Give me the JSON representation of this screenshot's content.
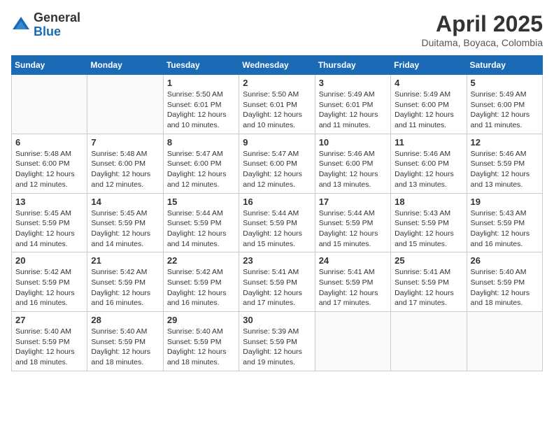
{
  "logo": {
    "general": "General",
    "blue": "Blue"
  },
  "title": {
    "month": "April 2025",
    "location": "Duitama, Boyaca, Colombia"
  },
  "weekdays": [
    "Sunday",
    "Monday",
    "Tuesday",
    "Wednesday",
    "Thursday",
    "Friday",
    "Saturday"
  ],
  "weeks": [
    [
      {
        "day": "",
        "sunrise": "",
        "sunset": "",
        "daylight": ""
      },
      {
        "day": "",
        "sunrise": "",
        "sunset": "",
        "daylight": ""
      },
      {
        "day": "1",
        "sunrise": "Sunrise: 5:50 AM",
        "sunset": "Sunset: 6:01 PM",
        "daylight": "Daylight: 12 hours and 10 minutes."
      },
      {
        "day": "2",
        "sunrise": "Sunrise: 5:50 AM",
        "sunset": "Sunset: 6:01 PM",
        "daylight": "Daylight: 12 hours and 10 minutes."
      },
      {
        "day": "3",
        "sunrise": "Sunrise: 5:49 AM",
        "sunset": "Sunset: 6:01 PM",
        "daylight": "Daylight: 12 hours and 11 minutes."
      },
      {
        "day": "4",
        "sunrise": "Sunrise: 5:49 AM",
        "sunset": "Sunset: 6:00 PM",
        "daylight": "Daylight: 12 hours and 11 minutes."
      },
      {
        "day": "5",
        "sunrise": "Sunrise: 5:49 AM",
        "sunset": "Sunset: 6:00 PM",
        "daylight": "Daylight: 12 hours and 11 minutes."
      }
    ],
    [
      {
        "day": "6",
        "sunrise": "Sunrise: 5:48 AM",
        "sunset": "Sunset: 6:00 PM",
        "daylight": "Daylight: 12 hours and 12 minutes."
      },
      {
        "day": "7",
        "sunrise": "Sunrise: 5:48 AM",
        "sunset": "Sunset: 6:00 PM",
        "daylight": "Daylight: 12 hours and 12 minutes."
      },
      {
        "day": "8",
        "sunrise": "Sunrise: 5:47 AM",
        "sunset": "Sunset: 6:00 PM",
        "daylight": "Daylight: 12 hours and 12 minutes."
      },
      {
        "day": "9",
        "sunrise": "Sunrise: 5:47 AM",
        "sunset": "Sunset: 6:00 PM",
        "daylight": "Daylight: 12 hours and 12 minutes."
      },
      {
        "day": "10",
        "sunrise": "Sunrise: 5:46 AM",
        "sunset": "Sunset: 6:00 PM",
        "daylight": "Daylight: 12 hours and 13 minutes."
      },
      {
        "day": "11",
        "sunrise": "Sunrise: 5:46 AM",
        "sunset": "Sunset: 6:00 PM",
        "daylight": "Daylight: 12 hours and 13 minutes."
      },
      {
        "day": "12",
        "sunrise": "Sunrise: 5:46 AM",
        "sunset": "Sunset: 5:59 PM",
        "daylight": "Daylight: 12 hours and 13 minutes."
      }
    ],
    [
      {
        "day": "13",
        "sunrise": "Sunrise: 5:45 AM",
        "sunset": "Sunset: 5:59 PM",
        "daylight": "Daylight: 12 hours and 14 minutes."
      },
      {
        "day": "14",
        "sunrise": "Sunrise: 5:45 AM",
        "sunset": "Sunset: 5:59 PM",
        "daylight": "Daylight: 12 hours and 14 minutes."
      },
      {
        "day": "15",
        "sunrise": "Sunrise: 5:44 AM",
        "sunset": "Sunset: 5:59 PM",
        "daylight": "Daylight: 12 hours and 14 minutes."
      },
      {
        "day": "16",
        "sunrise": "Sunrise: 5:44 AM",
        "sunset": "Sunset: 5:59 PM",
        "daylight": "Daylight: 12 hours and 15 minutes."
      },
      {
        "day": "17",
        "sunrise": "Sunrise: 5:44 AM",
        "sunset": "Sunset: 5:59 PM",
        "daylight": "Daylight: 12 hours and 15 minutes."
      },
      {
        "day": "18",
        "sunrise": "Sunrise: 5:43 AM",
        "sunset": "Sunset: 5:59 PM",
        "daylight": "Daylight: 12 hours and 15 minutes."
      },
      {
        "day": "19",
        "sunrise": "Sunrise: 5:43 AM",
        "sunset": "Sunset: 5:59 PM",
        "daylight": "Daylight: 12 hours and 16 minutes."
      }
    ],
    [
      {
        "day": "20",
        "sunrise": "Sunrise: 5:42 AM",
        "sunset": "Sunset: 5:59 PM",
        "daylight": "Daylight: 12 hours and 16 minutes."
      },
      {
        "day": "21",
        "sunrise": "Sunrise: 5:42 AM",
        "sunset": "Sunset: 5:59 PM",
        "daylight": "Daylight: 12 hours and 16 minutes."
      },
      {
        "day": "22",
        "sunrise": "Sunrise: 5:42 AM",
        "sunset": "Sunset: 5:59 PM",
        "daylight": "Daylight: 12 hours and 16 minutes."
      },
      {
        "day": "23",
        "sunrise": "Sunrise: 5:41 AM",
        "sunset": "Sunset: 5:59 PM",
        "daylight": "Daylight: 12 hours and 17 minutes."
      },
      {
        "day": "24",
        "sunrise": "Sunrise: 5:41 AM",
        "sunset": "Sunset: 5:59 PM",
        "daylight": "Daylight: 12 hours and 17 minutes."
      },
      {
        "day": "25",
        "sunrise": "Sunrise: 5:41 AM",
        "sunset": "Sunset: 5:59 PM",
        "daylight": "Daylight: 12 hours and 17 minutes."
      },
      {
        "day": "26",
        "sunrise": "Sunrise: 5:40 AM",
        "sunset": "Sunset: 5:59 PM",
        "daylight": "Daylight: 12 hours and 18 minutes."
      }
    ],
    [
      {
        "day": "27",
        "sunrise": "Sunrise: 5:40 AM",
        "sunset": "Sunset: 5:59 PM",
        "daylight": "Daylight: 12 hours and 18 minutes."
      },
      {
        "day": "28",
        "sunrise": "Sunrise: 5:40 AM",
        "sunset": "Sunset: 5:59 PM",
        "daylight": "Daylight: 12 hours and 18 minutes."
      },
      {
        "day": "29",
        "sunrise": "Sunrise: 5:40 AM",
        "sunset": "Sunset: 5:59 PM",
        "daylight": "Daylight: 12 hours and 18 minutes."
      },
      {
        "day": "30",
        "sunrise": "Sunrise: 5:39 AM",
        "sunset": "Sunset: 5:59 PM",
        "daylight": "Daylight: 12 hours and 19 minutes."
      },
      {
        "day": "",
        "sunrise": "",
        "sunset": "",
        "daylight": ""
      },
      {
        "day": "",
        "sunrise": "",
        "sunset": "",
        "daylight": ""
      },
      {
        "day": "",
        "sunrise": "",
        "sunset": "",
        "daylight": ""
      }
    ]
  ]
}
